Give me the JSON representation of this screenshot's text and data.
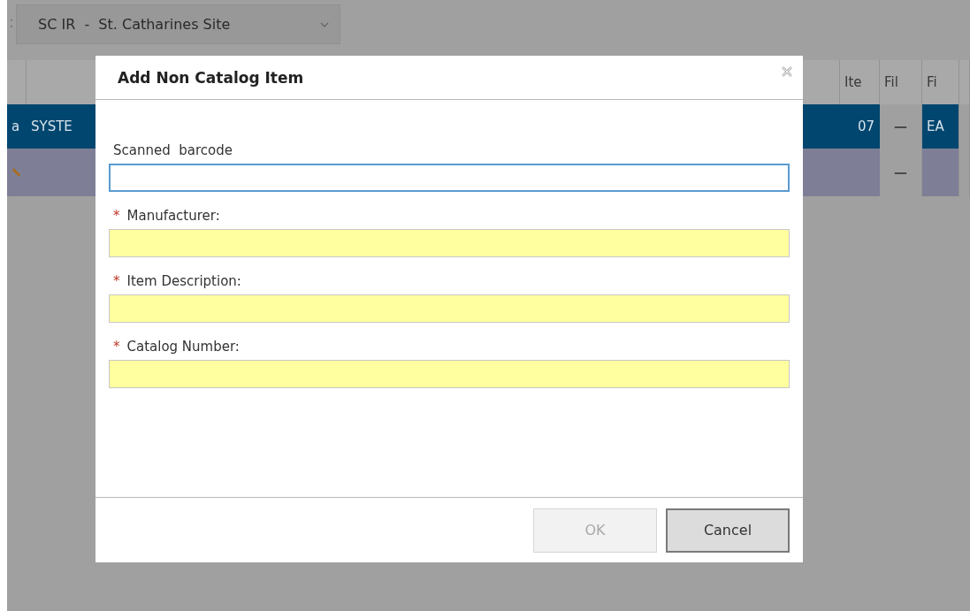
{
  "toolbar": {
    "label_fragment": ":",
    "site_select": "SC IR  -  St. Catharines Site"
  },
  "grid": {
    "headers": {
      "item": "Ite",
      "fill": "Fil",
      "fi": "Fi"
    },
    "rows": [
      {
        "selected": true,
        "kind": "data",
        "col_1": "a",
        "col_2": "SYSTE",
        "item": "07",
        "fill": "—",
        "fi": "EA"
      },
      {
        "selected": false,
        "kind": "edit",
        "fill": "—"
      }
    ]
  },
  "dialog": {
    "title": "Add Non Catalog Item",
    "fields": [
      {
        "label": "Scanned  barcode",
        "required": false,
        "focused": true
      },
      {
        "label": "Manufacturer:",
        "required": true,
        "required_mark": "*",
        "focused": false
      },
      {
        "label": "Item Description:",
        "required": true,
        "required_mark": "*",
        "focused": false
      },
      {
        "label": "Catalog Number:",
        "required": true,
        "required_mark": "*",
        "focused": false
      }
    ],
    "buttons": [
      {
        "label": "OK",
        "disabled": true
      },
      {
        "label": "Cancel",
        "disabled": false
      }
    ]
  }
}
